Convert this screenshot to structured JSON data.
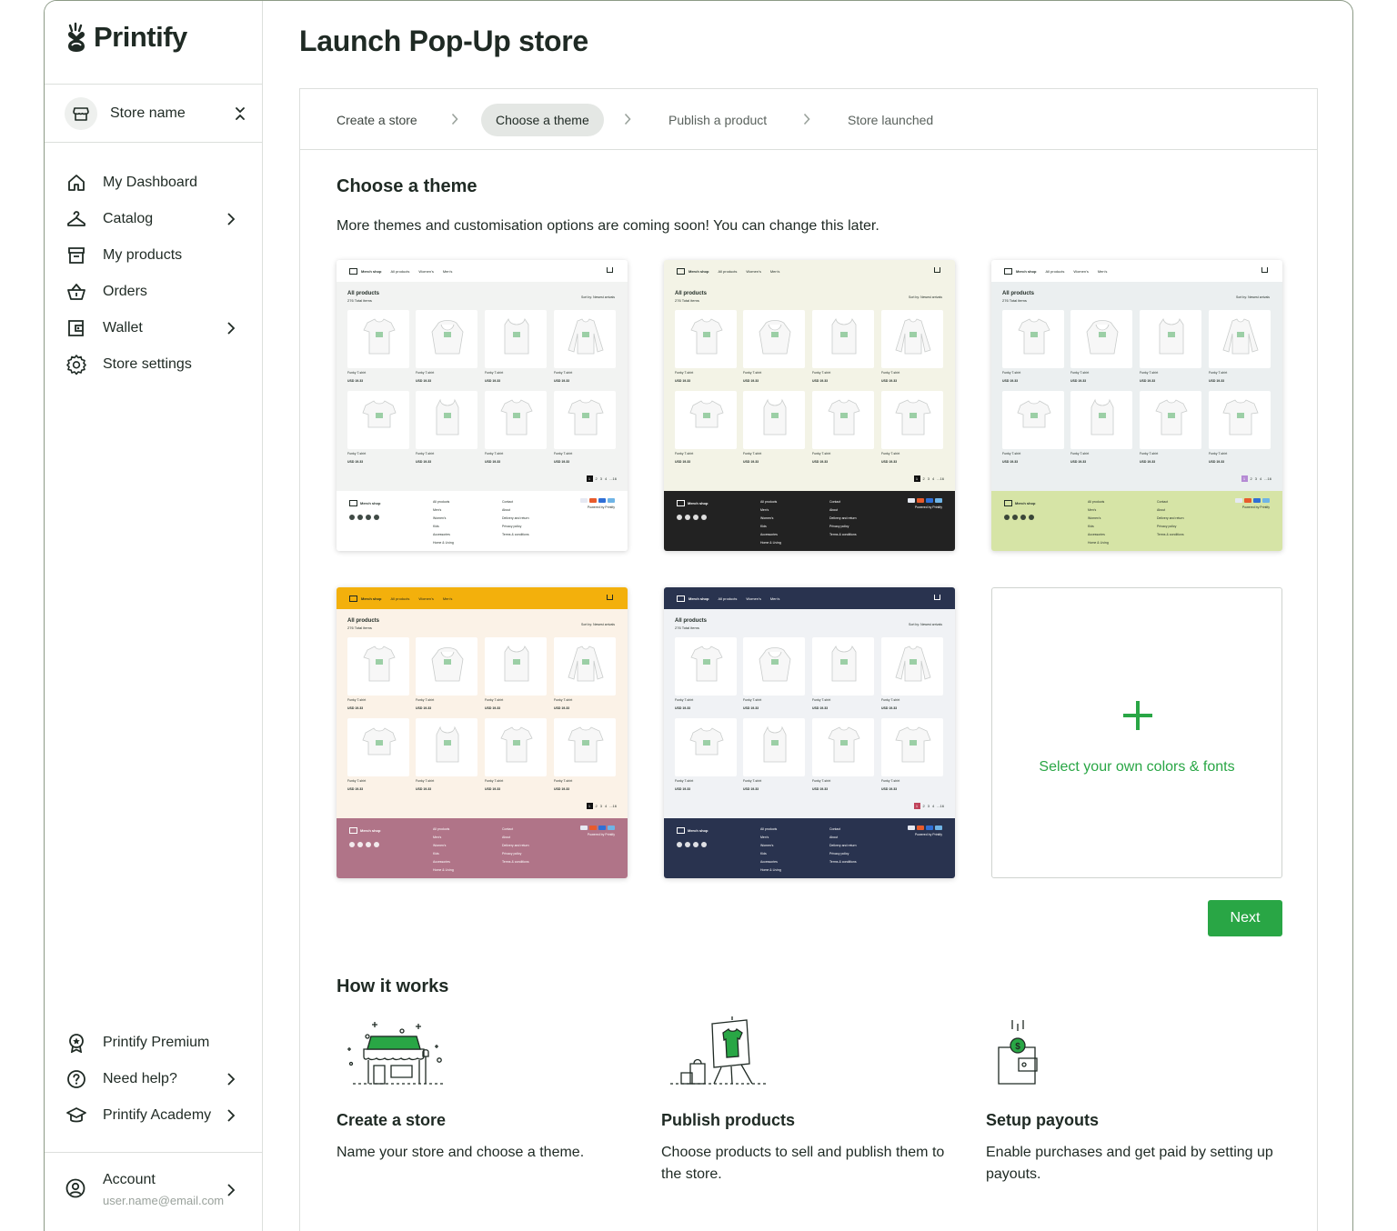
{
  "app": {
    "brand": "Printify"
  },
  "store": {
    "name": "Store name"
  },
  "nav": {
    "items": [
      {
        "label": "My Dashboard",
        "icon": "home-icon",
        "chevron": false
      },
      {
        "label": "Catalog",
        "icon": "hanger-icon",
        "chevron": true
      },
      {
        "label": "My products",
        "icon": "archive-box-icon",
        "chevron": false
      },
      {
        "label": "Orders",
        "icon": "basket-icon",
        "chevron": false
      },
      {
        "label": "Wallet",
        "icon": "wallet-icon",
        "chevron": true
      },
      {
        "label": "Store settings",
        "icon": "gear-icon",
        "chevron": false
      }
    ],
    "bottom": [
      {
        "label": "Printify Premium",
        "icon": "premium-badge-icon",
        "chevron": false
      },
      {
        "label": "Need help?",
        "icon": "help-circle-icon",
        "chevron": true
      },
      {
        "label": "Printify Academy",
        "icon": "graduation-cap-icon",
        "chevron": true
      }
    ],
    "account": {
      "label": "Account",
      "email": "user.name@email.com"
    }
  },
  "page": {
    "title": "Launch Pop-Up store"
  },
  "steps": [
    {
      "label": "Create a store",
      "state": "done"
    },
    {
      "label": "Choose a theme",
      "state": "active"
    },
    {
      "label": "Publish a product",
      "state": "upcoming"
    },
    {
      "label": "Store launched",
      "state": "upcoming"
    }
  ],
  "theme_section": {
    "title": "Choose a theme",
    "description": "More themes and customisation options are coming soon!  You can change this later.",
    "preview_text": {
      "shop": "Merch shop",
      "nav": [
        "All products",
        "Women's",
        "Men's"
      ],
      "heading": "All products",
      "sub": "276 Total items",
      "sort": "Sort by:  Newest arrivals",
      "product_name": "Funky T-shirt",
      "product_price": "USD 19.33",
      "pages": [
        "1",
        "2",
        "3",
        "4",
        "...16"
      ],
      "footer_col1": [
        "All products",
        "Men's",
        "Women's",
        "Kids",
        "Accessories",
        "Home & Living"
      ],
      "footer_col2": [
        "Contact",
        "About",
        "Delivery and return",
        "Privacy policy",
        "Terms & conditions"
      ],
      "powered": "Powered by Printify"
    },
    "themes": [
      {
        "name": "light",
        "header_bg": "#ffffff",
        "header_fg": "#1f2a24",
        "body_bg": "#f2f3f2",
        "footer_bg": "#ffffff",
        "footer_fg": "#1f2a24",
        "accent": "#111111"
      },
      {
        "name": "olive-dark",
        "header_bg": "#f3f3e6",
        "header_fg": "#1f2a24",
        "body_bg": "#f3f3e6",
        "footer_bg": "#222222",
        "footer_fg": "#ffffff",
        "accent": "#111111"
      },
      {
        "name": "mint-lime",
        "header_bg": "#ffffff",
        "header_fg": "#1f2a24",
        "body_bg": "#ebeff0",
        "footer_bg": "#d6e4a6",
        "footer_fg": "#1f2a24",
        "accent": "#b58ad4"
      },
      {
        "name": "sunset",
        "header_bg": "#f3b00c",
        "header_fg": "#1f2a24",
        "body_bg": "#fbf2e7",
        "footer_bg": "#b07488",
        "footer_fg": "#ffffff",
        "accent": "#111111"
      },
      {
        "name": "navy",
        "header_bg": "#29334f",
        "header_fg": "#ffffff",
        "body_bg": "#f0f2f5",
        "footer_bg": "#29334f",
        "footer_fg": "#ffffff",
        "accent": "#c0445b"
      }
    ],
    "custom_label": "Select your own colors & fonts",
    "next_label": "Next"
  },
  "how_it_works": {
    "title": "How it works",
    "items": [
      {
        "title": "Create a store",
        "desc": "Name your store and choose a theme.",
        "icon": "storefront-illustration"
      },
      {
        "title": "Publish products",
        "desc": "Choose products to sell and publish them to the store.",
        "icon": "easel-tshirt-illustration"
      },
      {
        "title": "Setup payouts",
        "desc": "Enable purchases and get paid by setting up payouts.",
        "icon": "wallet-coin-illustration"
      }
    ]
  },
  "colors": {
    "brand_green": "#29a645",
    "text": "#1f2a24",
    "border": "#dcdfdc"
  }
}
